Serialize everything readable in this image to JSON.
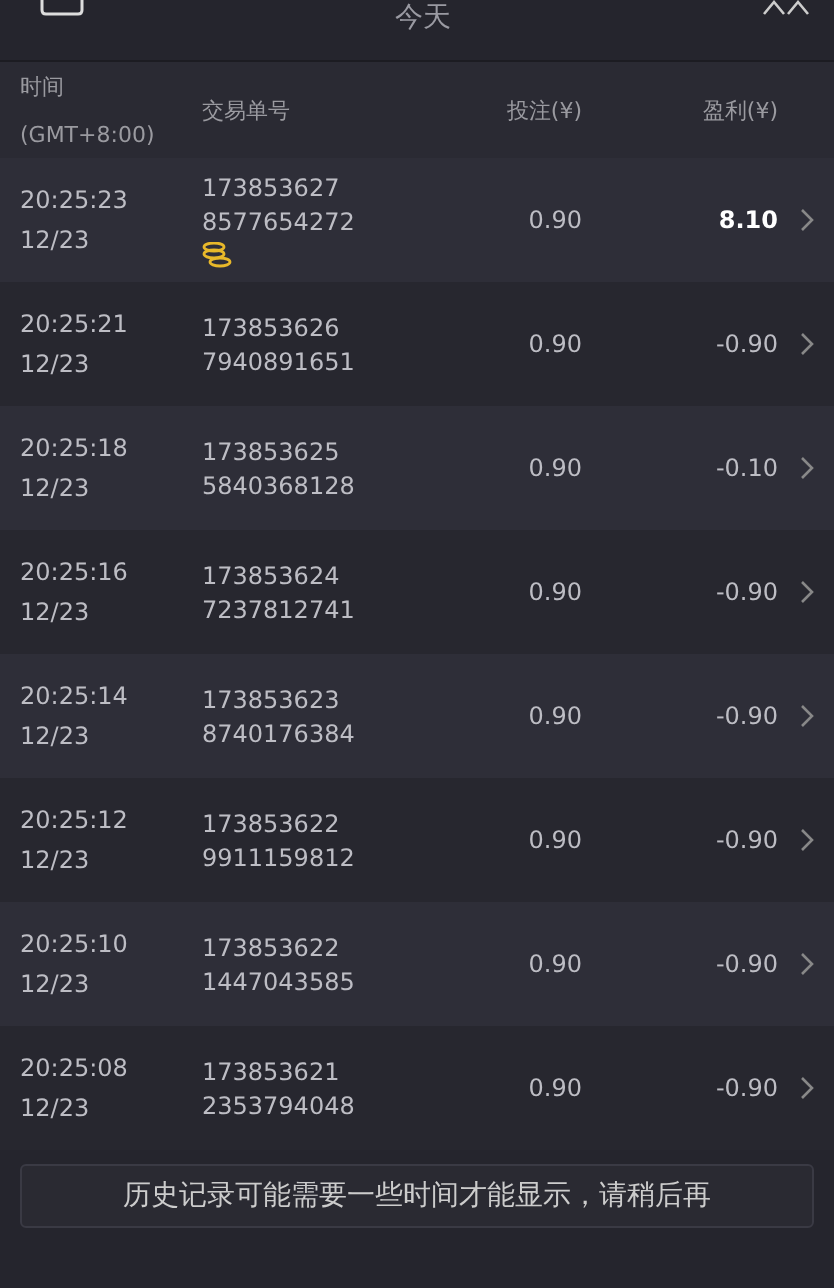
{
  "header": {
    "title": "今天"
  },
  "table": {
    "columns": [
      {
        "label": "时间",
        "sub": "(GMT+8:00)"
      },
      {
        "label": "交易单号"
      },
      {
        "label": "投注(¥)"
      },
      {
        "label": "盈利(¥)"
      }
    ],
    "rows": [
      {
        "time": "20:25:23",
        "date": "12/23",
        "id1": "173853627",
        "id2": "8577654272",
        "coin": true,
        "stake": "0.90",
        "profit": "8.10",
        "won": true
      },
      {
        "time": "20:25:21",
        "date": "12/23",
        "id1": "173853626",
        "id2": "7940891651",
        "coin": false,
        "stake": "0.90",
        "profit": "-0.90",
        "won": false
      },
      {
        "time": "20:25:18",
        "date": "12/23",
        "id1": "173853625",
        "id2": "5840368128",
        "coin": false,
        "stake": "0.90",
        "profit": "-0.10",
        "won": false
      },
      {
        "time": "20:25:16",
        "date": "12/23",
        "id1": "173853624",
        "id2": "7237812741",
        "coin": false,
        "stake": "0.90",
        "profit": "-0.90",
        "won": false
      },
      {
        "time": "20:25:14",
        "date": "12/23",
        "id1": "173853623",
        "id2": "8740176384",
        "coin": false,
        "stake": "0.90",
        "profit": "-0.90",
        "won": false
      },
      {
        "time": "20:25:12",
        "date": "12/23",
        "id1": "173853622",
        "id2": "9911159812",
        "coin": false,
        "stake": "0.90",
        "profit": "-0.90",
        "won": false
      },
      {
        "time": "20:25:10",
        "date": "12/23",
        "id1": "173853622",
        "id2": "1447043585",
        "coin": false,
        "stake": "0.90",
        "profit": "-0.90",
        "won": false
      },
      {
        "time": "20:25:08",
        "date": "12/23",
        "id1": "173853621",
        "id2": "2353794048",
        "coin": false,
        "stake": "0.90",
        "profit": "-0.90",
        "won": false
      }
    ]
  },
  "notice": "历史记录可能需要一些时间才能显示，请稍后再"
}
